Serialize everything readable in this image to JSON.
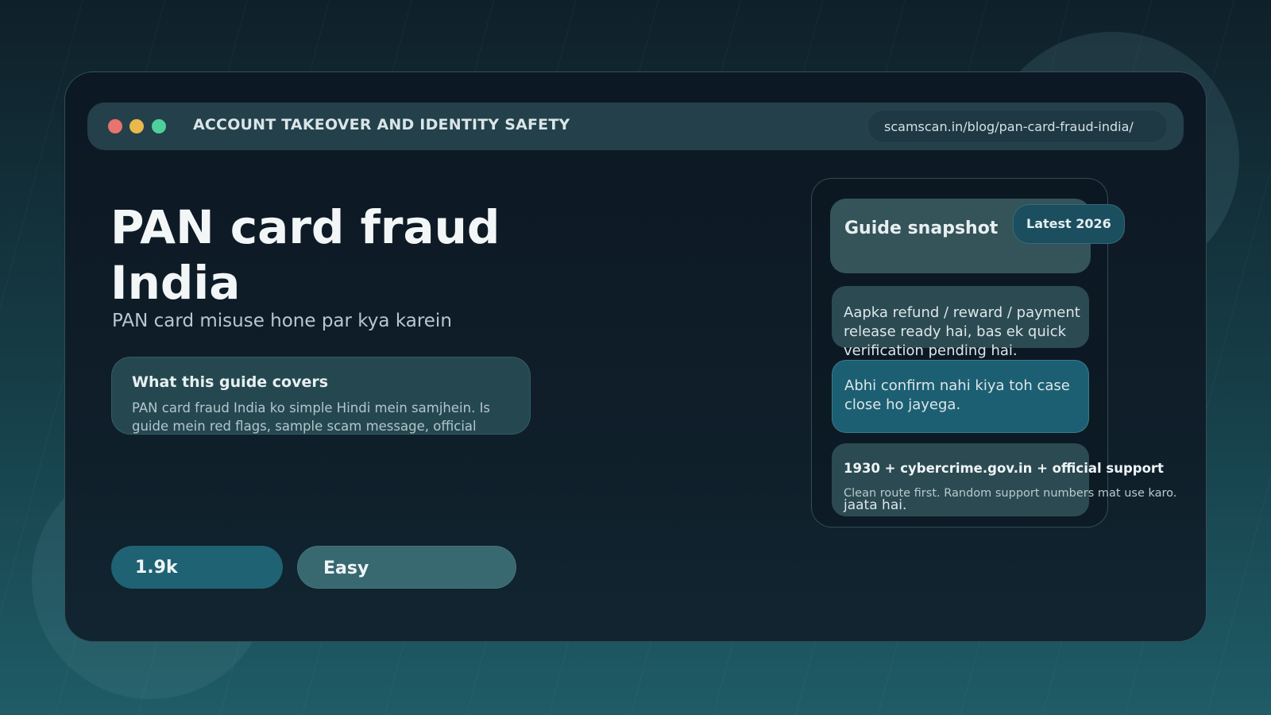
{
  "window": {
    "title": "ACCOUNT TAKEOVER AND IDENTITY SAFETY",
    "url": "scamscan.in/blog/pan-card-fraud-india/"
  },
  "article": {
    "title": "PAN card fraud India",
    "subtitle": "PAN card misuse hone par kya karein",
    "covers": {
      "heading": "What this guide covers",
      "text": "PAN card fraud India ko simple Hindi mein samjhein. Is guide mein red flags, sample scam message, official"
    },
    "stats": {
      "views": "1.9k",
      "difficulty": "Easy"
    }
  },
  "snapshot": {
    "title": "Guide snapshot",
    "badge": "Latest 2026",
    "scam_message": "Aapka refund / reward / payment release ready hai, bas ek quick verification pending hai.",
    "urgency_message": "Abhi confirm nahi kiya toh case close ho jayega.",
    "report": {
      "heading": "1930 + cybercrime.gov.in + official support",
      "text": "Clean route first. Random support numbers mat use karo.",
      "overflow": "jaata hai."
    }
  },
  "colors": {
    "dot_red": "#e8736f",
    "dot_yellow": "#e9b94c",
    "dot_green": "#4fcf9b",
    "accent_teal": "#1f6274"
  }
}
